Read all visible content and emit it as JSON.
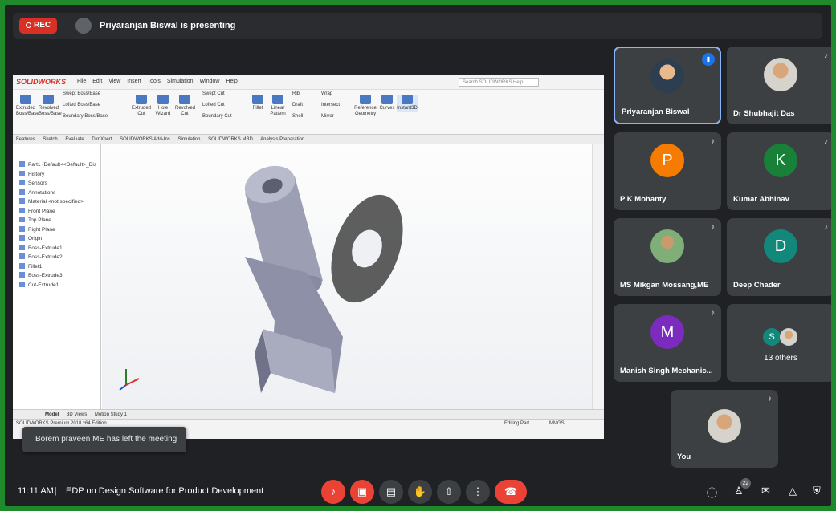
{
  "recording": {
    "label": "REC"
  },
  "presenting": {
    "text": "Priyaranjan Biswal is presenting"
  },
  "share": {
    "app_logo": "SOLIDWORKS",
    "menu": [
      "File",
      "Edit",
      "View",
      "Insert",
      "Tools",
      "Simulation",
      "Window",
      "Help"
    ],
    "search_placeholder": "Search SOLIDWORKS Help",
    "ribbon": [
      "Extruded Boss/Base",
      "Revolved Boss/Base",
      "Swept Boss/Base",
      "Lofted Boss/Base",
      "Boundary Boss/Base",
      "Extruded Cut",
      "Hole Wizard",
      "Revolved Cut",
      "Swept Cut",
      "Lofted Cut",
      "Boundary Cut",
      "Fillet",
      "Linear Pattern",
      "Rib",
      "Draft",
      "Shell",
      "Wrap",
      "Intersect",
      "Mirror",
      "Reference Geometry",
      "Curves",
      "Instant3D"
    ],
    "tabs": [
      "Features",
      "Sketch",
      "Evaluate",
      "DimXpert",
      "SOLIDWORKS Add-Ins",
      "Simulation",
      "SOLIDWORKS MBD",
      "Analysis Preparation"
    ],
    "tree": [
      "Part1 (Default<<Default>_Dis",
      "History",
      "Sensors",
      "Annotations",
      "Material <not specified>",
      "Front Plane",
      "Top Plane",
      "Right Plane",
      "Origin",
      "Boss-Extrude1",
      "Boss-Extrude2",
      "Fillet1",
      "Boss-Extrude3",
      "Cut-Extrude1"
    ],
    "bottom_tabs": [
      "Model",
      "3D Views",
      "Motion Study 1"
    ],
    "status_left": "SOLIDWORKS Premium 2018 x64 Edition",
    "status_right": "Editing Part",
    "units": "MMGS"
  },
  "toast": {
    "text": "Borem praveen ME has left the meeting"
  },
  "participants": [
    {
      "name": "Priyaranjan Biswal",
      "initial": "",
      "color": "",
      "type": "photo",
      "speaking": true
    },
    {
      "name": "Dr Shubhajit Das",
      "initial": "",
      "color": "",
      "type": "photo-alt",
      "speaking": false
    },
    {
      "name": "P K Mohanty",
      "initial": "P",
      "color": "#f57c00",
      "type": "letter",
      "speaking": false
    },
    {
      "name": "Kumar Abhinav",
      "initial": "K",
      "color": "#188038",
      "type": "letter",
      "speaking": false
    },
    {
      "name": "MS Mikgan Mossang,ME",
      "initial": "",
      "color": "",
      "type": "photo-alt2",
      "speaking": false
    },
    {
      "name": "Deep Chader",
      "initial": "D",
      "color": "#12887a",
      "type": "letter",
      "speaking": false
    },
    {
      "name": "Manish Singh Mechanic...",
      "initial": "M",
      "color": "#7b2cbf",
      "type": "letter",
      "speaking": false
    }
  ],
  "others": {
    "initial": "S",
    "initial_color": "#12887a",
    "label": "13 others"
  },
  "self": {
    "name": "You"
  },
  "bottom": {
    "time": "11:11 AM",
    "separator": "|",
    "meeting_title": "EDP on Design Software for Product Development",
    "people_count": "22"
  }
}
